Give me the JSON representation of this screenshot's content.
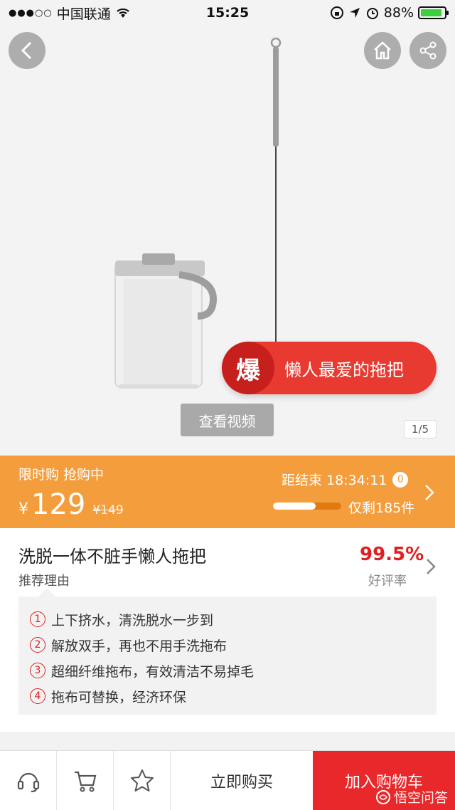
{
  "status_bar": {
    "carrier": "中国联通",
    "time": "15:25",
    "battery": "88%"
  },
  "hero": {
    "promo_badge": "爆",
    "promo_text": "懒人最爱的拖把",
    "video_button": "查看视频",
    "page_indicator": "1/5"
  },
  "flash_sale": {
    "label": "限时购 抢购中",
    "currency": "¥",
    "price": "129",
    "original_price": "¥149",
    "countdown_label": "距结束 18:34:11",
    "countdown_badge": "0",
    "stock_text": "仅剩185件",
    "stock_fraction": 0.62
  },
  "product": {
    "title": "洗脱一体不脏手懒人拖把",
    "recommend_label": "推荐理由",
    "rating_value": "99.5%",
    "rating_label": "好评率",
    "reasons": [
      {
        "num": "1",
        "text": "上下挤水，清洗脱水一步到"
      },
      {
        "num": "2",
        "text": "解放双手，再也不用手洗拖布"
      },
      {
        "num": "3",
        "text": "超细纤维拖布，有效清洁不易掉毛"
      },
      {
        "num": "4",
        "text": "拖布可替换，经济环保"
      }
    ]
  },
  "bottom_bar": {
    "buy_now": "立即购买",
    "add_to_cart": "加入购物车",
    "watermark": "悟空问答"
  },
  "colors": {
    "flash_orange": "#f49d3c",
    "accent_red": "#e8282a"
  }
}
